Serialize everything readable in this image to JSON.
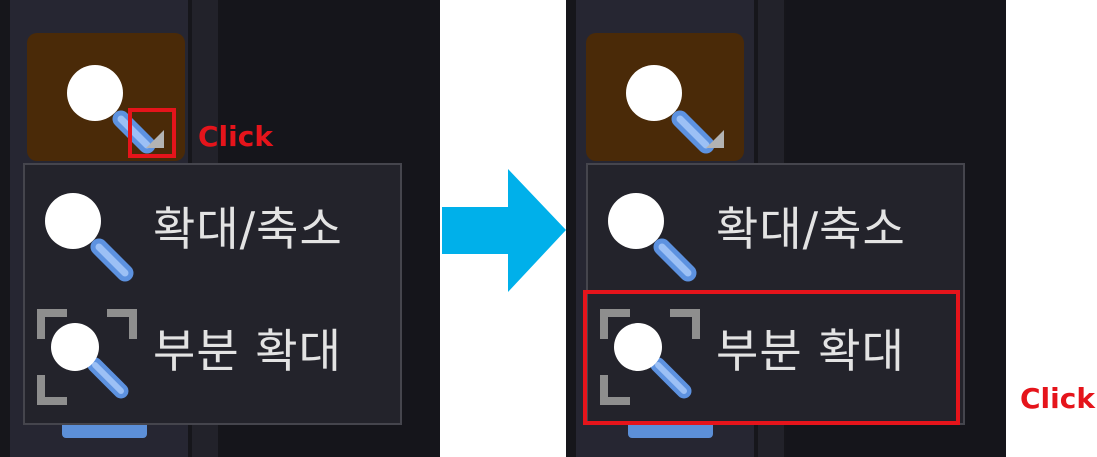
{
  "colors": {
    "highlight": "#e5141b",
    "arrow": "#00b0ea",
    "panel_bg": "#16161b",
    "button_bg": "#4a2a08",
    "menu_bg": "#23232b"
  },
  "left_panel": {
    "toolbar": {
      "zoom_button_icon": "magnifier-icon",
      "dropdown_indicator_icon": "triangle-expand-icon"
    },
    "dropdown": {
      "items": [
        {
          "label": "확대/축소",
          "icon": "magnifier-icon"
        },
        {
          "label": "부분 확대",
          "icon": "partial-zoom-icon"
        }
      ]
    },
    "annotation": "Click"
  },
  "transition_arrow_icon": "right-arrow-icon",
  "right_panel": {
    "toolbar": {
      "zoom_button_icon": "magnifier-icon",
      "dropdown_indicator_icon": "triangle-expand-icon"
    },
    "dropdown": {
      "items": [
        {
          "label": "확대/축소",
          "icon": "magnifier-icon"
        },
        {
          "label": "부분 확대",
          "icon": "partial-zoom-icon",
          "highlighted": true
        }
      ]
    },
    "annotation": "Click"
  }
}
